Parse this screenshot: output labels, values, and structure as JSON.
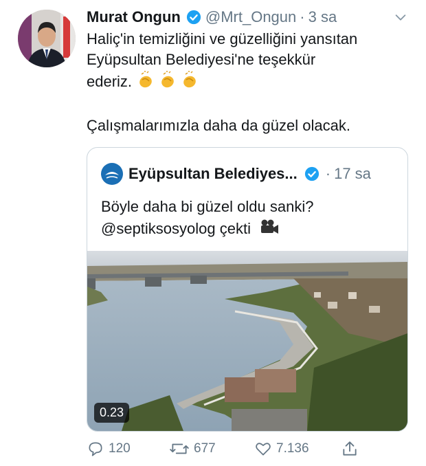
{
  "tweet": {
    "author_name": "Murat Ongun",
    "handle": "@Mrt_Ongun",
    "separator": "·",
    "time": "3 sa",
    "text_line1": "Haliç'in temizliğini ve güzelliğini yansıtan",
    "text_line2": "Eyüpsultan Belediyesi'ne teşekkür",
    "text_line3": "ederiz.",
    "text_line4": "Çalışmalarımızla daha da güzel olacak.",
    "emoji_icons": [
      "clapping-hands-icon",
      "clapping-hands-icon",
      "clapping-hands-icon"
    ]
  },
  "quoted": {
    "author_name": "Eyüpsultan Belediyes...",
    "separator": "·",
    "time": "17 sa",
    "text_line1": "Böyle daha bi güzel oldu sanki?",
    "text_line2": "@septiksosyolog çekti",
    "emoji_icon": "movie-camera-icon",
    "video_timer": "0.23"
  },
  "actions": {
    "reply_count": "120",
    "retweet_count": "677",
    "like_count": "7.136"
  },
  "colors": {
    "verified_blue": "#1da1f2",
    "secondary_text": "#657786",
    "border": "#ccd6dd",
    "logo_blue": "#1b6fb5"
  }
}
